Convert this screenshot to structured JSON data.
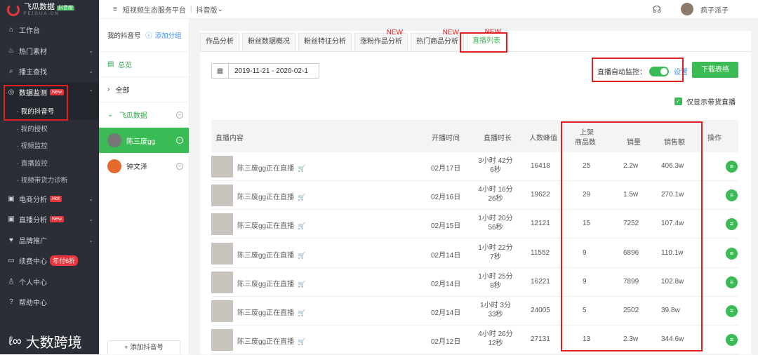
{
  "brand": {
    "name": "飞瓜数据",
    "badge": "抖音版",
    "sub": "FEIGUA.CN"
  },
  "topbar": {
    "platform": "短视频生态服务平台",
    "version": "抖音版",
    "username": "疯子派子"
  },
  "sidebar": {
    "items": [
      {
        "label": "工作台",
        "icon": "⌂"
      },
      {
        "label": "热门素材",
        "icon": "♨",
        "chev": "⌄"
      },
      {
        "label": "播主查找",
        "icon": "⌕",
        "chev": "⌄"
      },
      {
        "label": "数据监测",
        "icon": "◎",
        "badge": "New",
        "chev": "⌃"
      },
      {
        "label": "电商分析",
        "icon": "▣",
        "badge": "Hot",
        "chev": "⌄"
      },
      {
        "label": "直播分析",
        "icon": "▣",
        "badge": "New",
        "chev": "⌄"
      },
      {
        "label": "品牌推广",
        "icon": "♥",
        "chev": "⌄"
      },
      {
        "label": "续费中心",
        "icon": "▭",
        "badge": "年付6折"
      },
      {
        "label": "个人中心",
        "icon": "♙"
      },
      {
        "label": "帮助中心",
        "icon": "?"
      }
    ],
    "subitems": [
      "· 我的抖音号",
      "· 我的授权",
      "· 视频监控",
      "· 直播监控",
      "· 视频带货力诊断"
    ]
  },
  "account_panel": {
    "title": "我的抖音号",
    "add_group": "添加分组",
    "overview": "总览",
    "all": "全部",
    "group": "飞瓜数据",
    "accounts": [
      "陈三废gg",
      "钟文泽"
    ],
    "add_account": "+ 添加抖音号"
  },
  "tabs": [
    {
      "label": "作品分析"
    },
    {
      "label": "粉丝数据概况"
    },
    {
      "label": "粉丝特征分析"
    },
    {
      "label": "涨粉作品分析",
      "new": "NEW"
    },
    {
      "label": "热门商品分析",
      "new": "NEW"
    },
    {
      "label": "直播列表",
      "new": "NEW"
    }
  ],
  "controls": {
    "date_range": "2019-11-21 - 2020-02-1",
    "monitor_label": "直播自动监控：",
    "monitor_setting": "设置",
    "download": "下载表格",
    "only_goods": "仅显示带货直播"
  },
  "table": {
    "headers": {
      "content": "直播内容",
      "start": "开播时间",
      "duration": "直播时长",
      "peak": "人数峰值",
      "goods_1": "上架",
      "goods_2": "商品数",
      "sales": "销量",
      "revenue": "销售额",
      "action": "操作"
    },
    "rows": [
      {
        "title": "陈三废gg正在直播",
        "date": "02月17日",
        "dur1": "3小时 42分",
        "dur2": "6秒",
        "peak": "16418",
        "goods": "25",
        "sales": "2.2w",
        "revenue": "406.3w"
      },
      {
        "title": "陈三废gg正在直播",
        "date": "02月16日",
        "dur1": "4小时 16分",
        "dur2": "26秒",
        "peak": "19622",
        "goods": "29",
        "sales": "1.5w",
        "revenue": "270.1w"
      },
      {
        "title": "陈三废gg正在直播",
        "date": "02月15日",
        "dur1": "1小时 20分",
        "dur2": "56秒",
        "peak": "12121",
        "goods": "15",
        "sales": "7252",
        "revenue": "107.4w"
      },
      {
        "title": "陈三废gg正在直播",
        "date": "02月14日",
        "dur1": "1小时 22分",
        "dur2": "7秒",
        "peak": "11552",
        "goods": "9",
        "sales": "6896",
        "revenue": "110.1w"
      },
      {
        "title": "陈三废gg正在直播",
        "date": "02月14日",
        "dur1": "1小时 25分",
        "dur2": "8秒",
        "peak": "16221",
        "goods": "9",
        "sales": "7899",
        "revenue": "102.8w"
      },
      {
        "title": "陈三废gg正在直播",
        "date": "02月14日",
        "dur1": "1小时 3分",
        "dur2": "33秒",
        "peak": "24005",
        "goods": "5",
        "sales": "2502",
        "revenue": "39.8w"
      },
      {
        "title": "陈三废gg正在直播",
        "date": "02月12日",
        "dur1": "4小时 26分",
        "dur2": "12秒",
        "peak": "27131",
        "goods": "13",
        "sales": "2.3w",
        "revenue": "344.6w"
      }
    ]
  },
  "watermark": {
    "mark": "ℓ∞",
    "text": "大数跨境"
  },
  "colors": {
    "accent": "#3bbb55",
    "highlight": "#e02020",
    "link": "#3a8ee6",
    "sidebar": "#2b2e36"
  }
}
